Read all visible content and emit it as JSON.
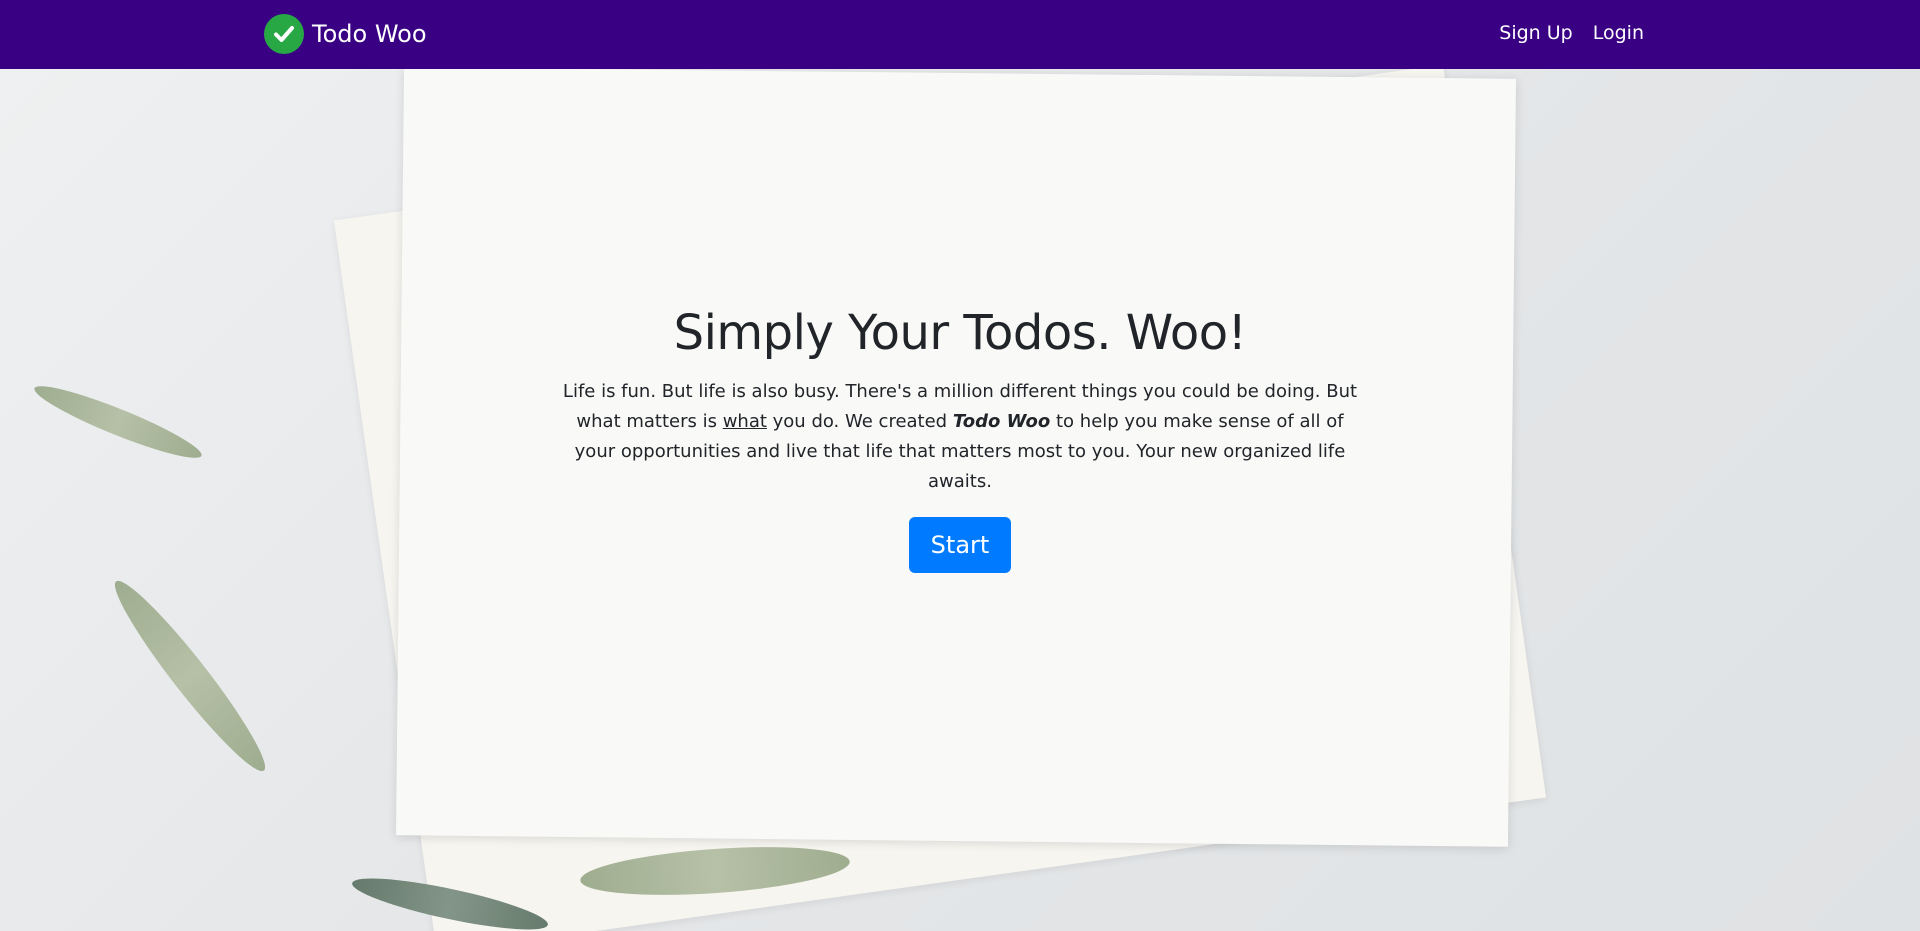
{
  "navbar": {
    "brand_icon": "check-circle-icon",
    "brand_name": "Todo Woo",
    "links": [
      {
        "label": "Sign Up"
      },
      {
        "label": "Login"
      }
    ],
    "background_color": "#3a0084"
  },
  "hero": {
    "title": "Simply Your Todos. Woo!",
    "text_part1": "Life is fun. But life is also busy. There's a million different things you could be doing. But what matters is ",
    "text_emphasis": "what",
    "text_part2": " you do. We created ",
    "text_brand": "Todo Woo",
    "text_part3": " to help you make sense of all of your opportunities and live that life that matters most to you. Your new organized life awaits.",
    "start_label": "Start",
    "button_color": "#007bff"
  }
}
